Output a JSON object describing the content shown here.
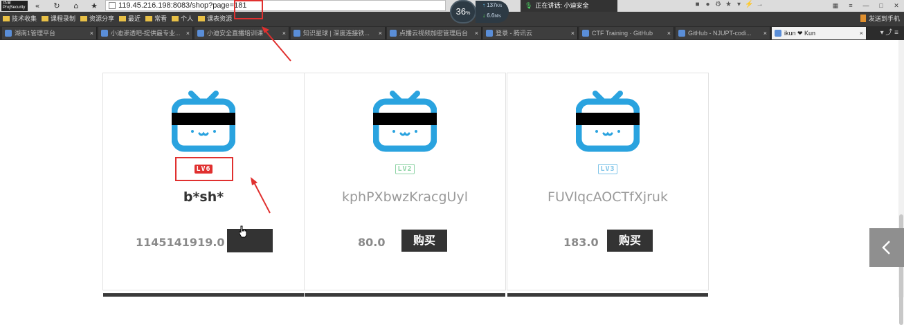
{
  "browser": {
    "logo_text": "迅雷 ProjSecurity",
    "url": "119.45.216.198:8083/shop?page=181",
    "net_widget": {
      "percent": "36",
      "percent_unit": "%",
      "up_rate": "137",
      "up_unit": "K/s",
      "down_rate": "6.6",
      "down_unit": "M/s"
    },
    "speaking_label": "正在讲话: 小迪安全",
    "bookmarks": [
      "技术收集",
      "课程录制",
      "资源分享",
      "最近",
      "常看",
      "个人",
      "课表资源"
    ],
    "send_to_phone": "发送到手机",
    "tabs": [
      {
        "label": "湖南1管理平台",
        "active": false
      },
      {
        "label": "小迪渗透吧-提供最专业...",
        "active": false
      },
      {
        "label": "小迪安全直播培训课",
        "active": false
      },
      {
        "label": "知识星球 | 深度连接铁...",
        "active": false
      },
      {
        "label": "点播云视频加密管理后台",
        "active": false
      },
      {
        "label": "登录 - 腾讯云",
        "active": false
      },
      {
        "label": "CTF Training · GitHub",
        "active": false
      },
      {
        "label": "GitHub - NJUPT-codi...",
        "active": false
      },
      {
        "label": "ikun ❤ Kun",
        "active": true
      }
    ],
    "tab_close": "×"
  },
  "products": [
    {
      "level": "LV6",
      "level_color": "#e0302f",
      "name": "b*sh*",
      "name_color": "#333333",
      "price": "1145141919.0",
      "buy_label": ""
    },
    {
      "level": "LV2",
      "level_color": "#8fd4a6",
      "name": "kphPXbwzKracgUyl",
      "name_color": "#9a9a9a",
      "price": "80.0",
      "buy_label": "购买"
    },
    {
      "level": "LV3",
      "level_color": "#7fc4e8",
      "name": "FUVlqcAOCTfXjruk",
      "name_color": "#9a9a9a",
      "price": "183.0",
      "buy_label": "购买"
    }
  ],
  "colors": {
    "tv_blue": "#2aa3df",
    "censor_bar": "#000000",
    "annotation_red": "#e0302f"
  },
  "side_nav": {
    "icon": "chevron-left-icon"
  }
}
